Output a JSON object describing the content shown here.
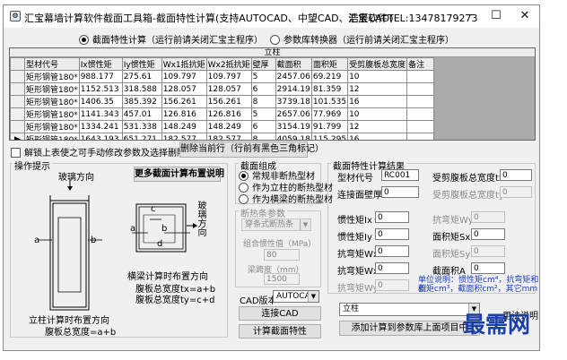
{
  "window": {
    "title": "汇宝幕墙计算软件截面工具箱-截面特性计算(支持AUTOCAD、中望CAD、浩辰CAD)",
    "company": "汇宝软件TEL:13478179273",
    "minimize_icon": "minimize-icon",
    "maximize_icon": "maximize-icon",
    "close_icon": "close-icon"
  },
  "mode": {
    "option1": "截面特性计算（运行前请关闭汇宝主程序）",
    "option2": "参数库转换器（运行前请关闭汇宝主程序）",
    "selected": 1
  },
  "grid": {
    "caption": "立柱",
    "columns": [
      "型材代号",
      "Ix惯性矩",
      "Iy惯性矩",
      "Wx1抵抗矩",
      "Wx2抵抗矩",
      "壁厚",
      "截面积",
      "面积矩",
      "受剪腹板总宽度",
      "备注"
    ],
    "rows": [
      [
        "矩形钢管180*",
        "988.177",
        "275.61",
        "109.797",
        "109.797",
        "5",
        "2457.06",
        "69.219",
        "10",
        ""
      ],
      [
        "矩形钢管180*",
        "1152.513",
        "318.588",
        "128.057",
        "128.057",
        "6",
        "2914.19",
        "81.359",
        "12",
        ""
      ],
      [
        "矩形钢管180*",
        "1406.35",
        "385.392",
        "156.261",
        "156.261",
        "8",
        "3739.18",
        "101.535",
        "16",
        ""
      ],
      [
        "矩形钢管180*",
        "1141.343",
        "457.01",
        "126.816",
        "126.816",
        "5",
        "2657.06",
        "77.969",
        "10",
        ""
      ],
      [
        "矩形钢管180*",
        "1334.241",
        "531.338",
        "148.249",
        "148.249",
        "6",
        "3154.19",
        "91.799",
        "12",
        ""
      ],
      [
        "矩形钢管180*",
        "1643.193",
        "651.271",
        "182.577",
        "182.577",
        "8",
        "4059.18",
        "115.295",
        "16",
        ""
      ]
    ],
    "current_row": 5,
    "current_marker": "▶",
    "new_marker": "*"
  },
  "unlock_label": "解锁上表使之可手动修改参数及选择删除行",
  "delete_row_button": "删除当前行（行前有黑色三角标记）",
  "ops": {
    "title": "操作提示",
    "glass_direction": "玻璃方向",
    "more_button": "更多截面计算布置说明",
    "glass_direction_vertical": "玻璃方向",
    "col_caption_1": "立柱计算时布置方向",
    "col_caption_2": "腹板总宽度=a+b",
    "beam_caption_1": "横梁计算时布置方向",
    "beam_caption_2": "腹板总宽度tx=a+b",
    "beam_caption_3": "腹板总宽度ty=c+d",
    "labels": {
      "a": "a",
      "b": "b",
      "c": "c",
      "d": "d"
    }
  },
  "composition": {
    "title": "截面组成",
    "options": [
      "常规非断热型材",
      "作为立柱的断热型材",
      "作为横梁的断热型材"
    ],
    "selected": 0,
    "thermal_title": "断热条参数",
    "thermal_type": "穿条式断热条",
    "combined_inertia_label": "组合惯性值（MPa）",
    "combined_inertia_value": "80",
    "beam_span_label": "梁跨度（mm）",
    "beam_span_value": "1500"
  },
  "cad": {
    "version_label": "CAD版本",
    "version_value": "AUTOCAD",
    "connect_button": "连接CAD",
    "calc_button": "计算截面特性"
  },
  "results": {
    "title": "截面特性计算结果",
    "profile_code_label": "型材代号",
    "profile_code_value": "RC001",
    "shear_tx_label": "受剪腹板总宽度tx",
    "shear_tx_value": "0",
    "wall_label": "连接面壁厚",
    "wall_value": "0",
    "shear_ty_label": "受剪腹板总宽度ty",
    "shear_ty_value": "0",
    "ix_label": "惯性矩Ix",
    "ix_value": "0",
    "wy2_label": "抗弯矩Wy2",
    "wy2_value": "0",
    "iy_label": "惯性矩Iy",
    "iy_value": "0",
    "sx_label": "面积矩Sx",
    "sx_value": "0",
    "wx1_label": "抗弯矩Wx1",
    "wx1_value": "0",
    "sy_label": "面积矩Sy",
    "sy_value": "0",
    "wx2_label": "抗弯矩Wx2",
    "wx2_value": "0",
    "area_label": "截面积A",
    "area_value": "0",
    "wy1_label": "抗弯矩Wy1",
    "wy1_value": "0",
    "unit_note_1": "单位说明：惯性矩cm⁴，抗弯矩和面",
    "unit_note_2": "积矩cm³，截面积cm²，其它mm"
  },
  "bottom": {
    "target_value": "立柱",
    "help_label": "用法说明",
    "add_button": "添加计算到参数库上面项目中"
  },
  "watermark": "最需网",
  "colors": {
    "accent_blue": "#1a3fbf",
    "window_bg": "#f0f0f0",
    "grid_bg": "#ababab"
  }
}
